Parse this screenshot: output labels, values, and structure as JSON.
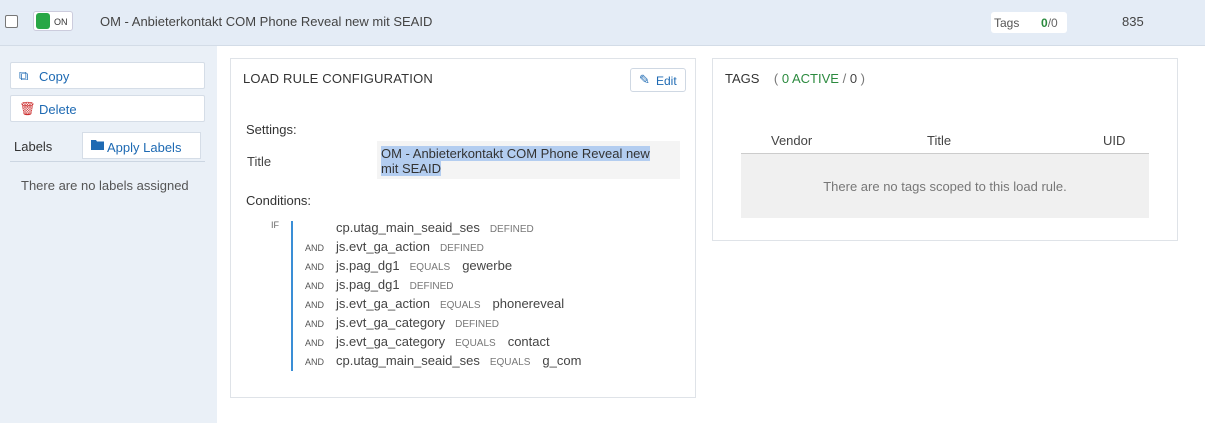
{
  "header": {
    "toggle_label": "ON",
    "title": "OM - Anbieterkontakt COM Phone Reveal new mit SEAID",
    "tags_label": "Tags",
    "tags_active": "0",
    "tags_sep": "/",
    "tags_total": "0",
    "id": "835"
  },
  "sidebar": {
    "copy_label": "Copy",
    "delete_label": "Delete",
    "labels_heading": "Labels",
    "apply_labels": "Apply Labels",
    "no_labels": "There are no labels assigned"
  },
  "load_rule": {
    "heading": "LOAD RULE CONFIGURATION",
    "edit_label": "Edit",
    "settings_label": "Settings:",
    "title_label": "Title",
    "title_value": "OM - Anbieterkontakt COM Phone Reveal new mit SEAID",
    "conditions_label": "Conditions:",
    "if_keyword": "IF",
    "conditions": [
      {
        "kw": "",
        "var": "cp.utag_main_seaid_ses",
        "op": "DEFINED",
        "val": ""
      },
      {
        "kw": "AND",
        "var": "js.evt_ga_action",
        "op": "DEFINED",
        "val": ""
      },
      {
        "kw": "AND",
        "var": "js.pag_dg1",
        "op": "EQUALS",
        "val": "gewerbe"
      },
      {
        "kw": "AND",
        "var": "js.pag_dg1",
        "op": "DEFINED",
        "val": ""
      },
      {
        "kw": "AND",
        "var": "js.evt_ga_action",
        "op": "EQUALS",
        "val": "phonereveal"
      },
      {
        "kw": "AND",
        "var": "js.evt_ga_category",
        "op": "DEFINED",
        "val": ""
      },
      {
        "kw": "AND",
        "var": "js.evt_ga_category",
        "op": "EQUALS",
        "val": "contact"
      },
      {
        "kw": "AND",
        "var": "cp.utag_main_seaid_ses",
        "op": "EQUALS",
        "val": "g_com"
      }
    ]
  },
  "tags_panel": {
    "heading": "TAGS",
    "paren_open": "(",
    "active_text": "0 ACTIVE",
    "slash": "/",
    "total": "0",
    "paren_close": ")",
    "columns": [
      "Vendor",
      "Title",
      "UID"
    ],
    "empty_message": "There are no tags scoped to this load rule."
  },
  "colors": {
    "accent": "#1e6ab3",
    "active_green": "#2b8a3e",
    "delete_red": "#cc2f2f",
    "selection": "#b3cdf0"
  }
}
